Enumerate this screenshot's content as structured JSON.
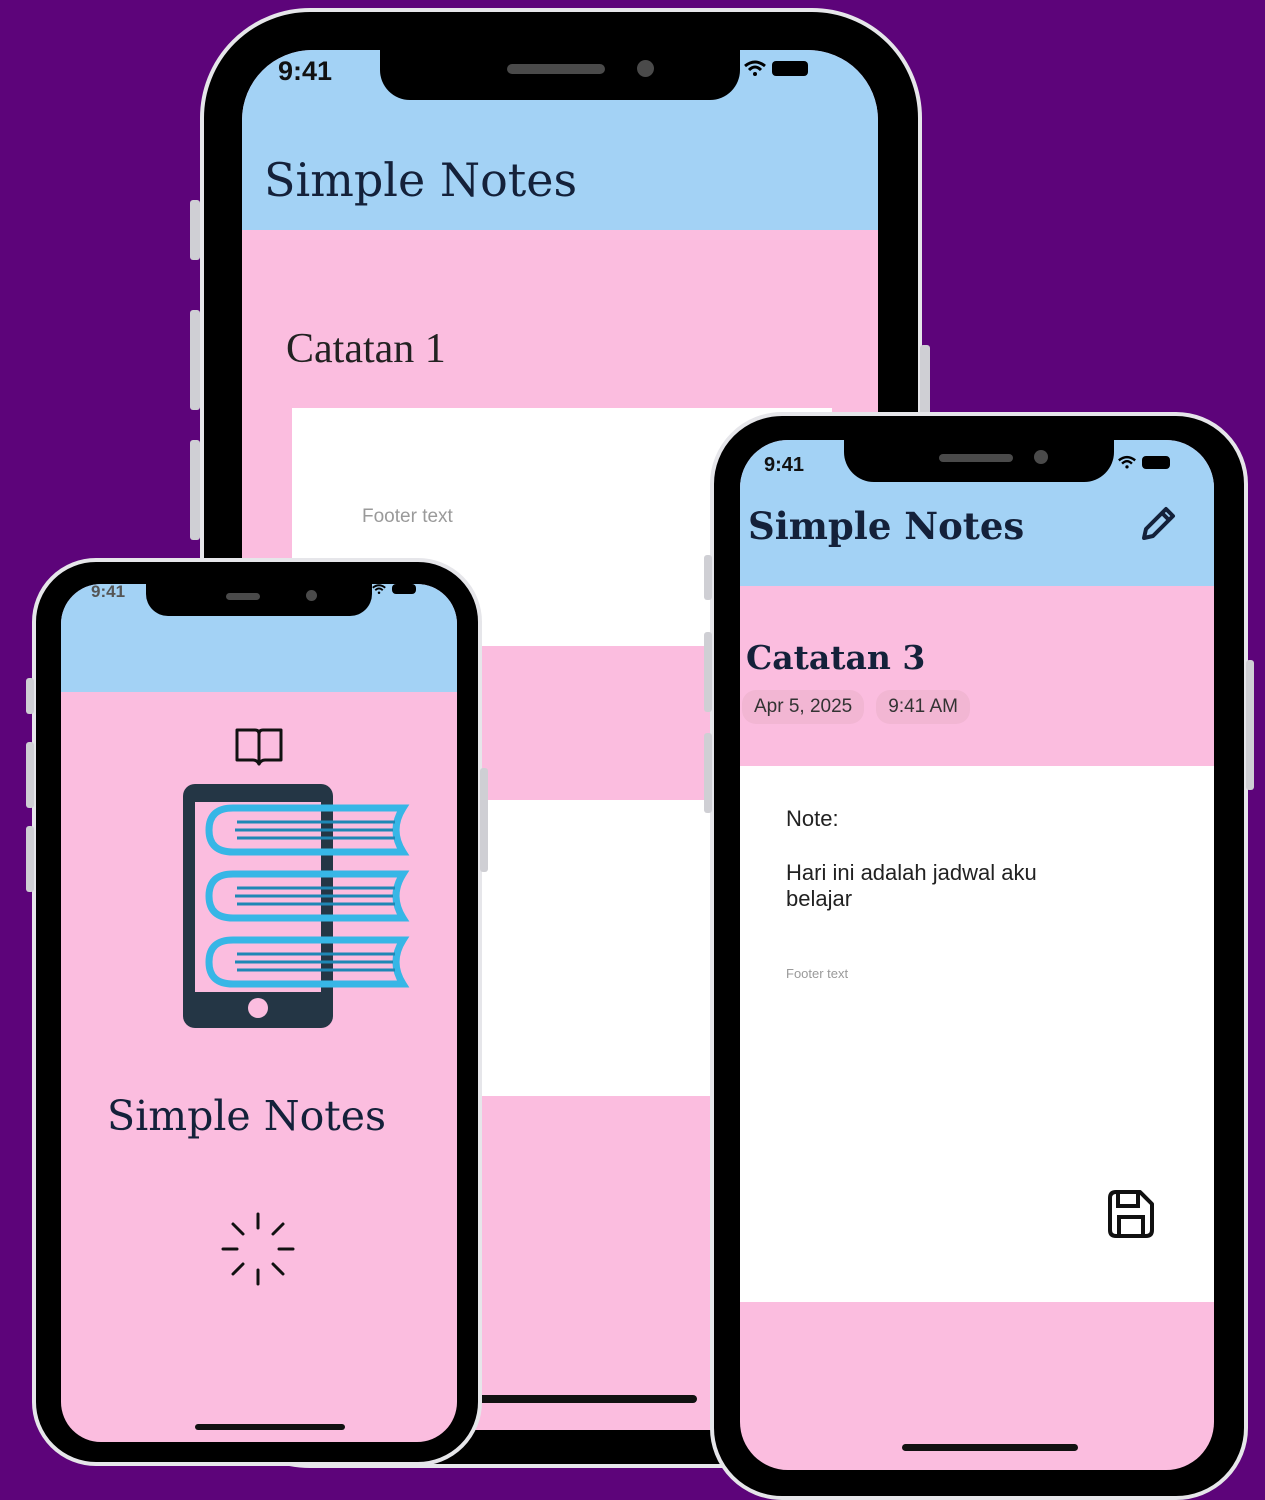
{
  "phone_back": {
    "time": "9:41",
    "app_title": "Simple Notes",
    "note_title": "Catatan 1",
    "footer": "Footer text"
  },
  "phone_left": {
    "time": "9:41",
    "app_title": "Simple Notes",
    "icons": [
      "book-open-icon",
      "phone-books-logo",
      "loading-spinner-icon"
    ]
  },
  "phone_right": {
    "time": "9:41",
    "app_title": "Simple Notes",
    "note_title": "Catatan 3",
    "date": "Apr 5, 2025",
    "clock": "9:41 AM",
    "note_label": "Note:",
    "note_body": "Hari ini adalah jadwal aku belajar",
    "footer": "Footer text",
    "icons": [
      "pencil-icon",
      "save-icon"
    ]
  },
  "colors": {
    "background": "#5d047a",
    "appbar": "#a3d2f5",
    "screen": "#fbbddf",
    "card": "#ffffff"
  }
}
